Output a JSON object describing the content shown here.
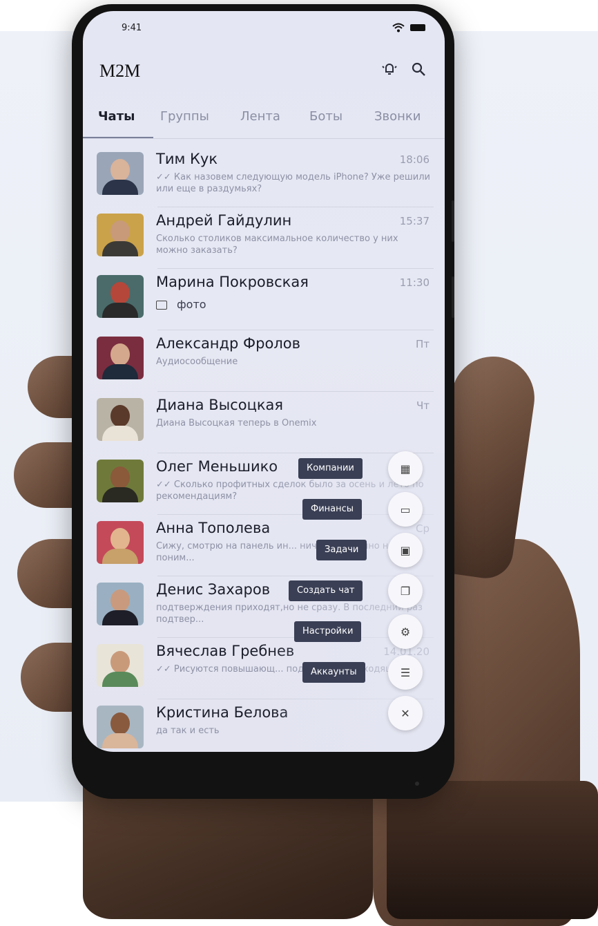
{
  "status": {
    "time": "9:41"
  },
  "app": {
    "title": "M2M"
  },
  "header_icons": [
    "bell-icon",
    "search-icon"
  ],
  "tabs": [
    {
      "label": "Чаты",
      "active": true
    },
    {
      "label": "Группы",
      "active": false
    },
    {
      "label": "Лента",
      "active": false
    },
    {
      "label": "Боты",
      "active": false
    },
    {
      "label": "Звонки",
      "active": false
    }
  ],
  "chats": [
    {
      "name": "Тим Кук",
      "time": "18:06",
      "preview": "✓✓ Как назовем следующую модель iPhone? Уже решили или еще в раздумьях?"
    },
    {
      "name": "Андрей Гайдулин",
      "time": "15:37",
      "preview": "Сколько столиков максимальное количество у них можно заказать?"
    },
    {
      "name": "Марина Покровская",
      "time": "11:30",
      "preview": "фото"
    },
    {
      "name": "Александр Фролов",
      "time": "Пт",
      "preview": "Аудиосообщение"
    },
    {
      "name": "Диана Высоцкая",
      "time": "Чт",
      "preview": "Диана Высоцкая теперь в Onemix"
    },
    {
      "name": "Олег Меньшико",
      "time": "",
      "preview": "✓✓ Сколько профитных сделок было за осень и лето по рекомендациям?"
    },
    {
      "name": "Анна Тополева",
      "time": "Ср",
      "preview": "Сижу, смотрю на панель ин... ничего особенно не поним..."
    },
    {
      "name": "Денис Захаров",
      "time": "",
      "preview": "подтверждения приходят,но не сразу. В последний раз подтвер..."
    },
    {
      "name": "Вячеслав Гребнев",
      "time": "14.01.20",
      "preview": "✓✓ Рисуются повышающ... поддержки, нисходящий..."
    },
    {
      "name": "Кристина Белова",
      "time": "",
      "preview": "да так и есть"
    }
  ],
  "fab_menu": [
    {
      "label": "Компании",
      "icon": "building-icon",
      "glyph": "▦"
    },
    {
      "label": "Финансы",
      "icon": "money-icon",
      "glyph": "▭"
    },
    {
      "label": "Задачи",
      "icon": "clipboard-icon",
      "glyph": "▣"
    },
    {
      "label": "Создать чат",
      "icon": "new-chat-icon",
      "glyph": "❐"
    },
    {
      "label": "Настройки",
      "icon": "gear-icon",
      "glyph": "⚙"
    },
    {
      "label": "Аккаунты",
      "icon": "accounts-icon",
      "glyph": "☰"
    }
  ],
  "fab_close": {
    "icon": "close-icon",
    "glyph": "✕"
  },
  "colors": {
    "accent": "#3a3f55",
    "screen_bg": "#e4e6f3"
  }
}
